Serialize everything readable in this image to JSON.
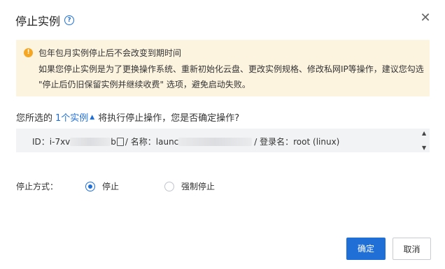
{
  "dialog": {
    "title": "停止实例",
    "close_glyph": "✕"
  },
  "notice": {
    "line1": "包年包月实例停止后不会改变到期时间",
    "line2": "如果您停止实例是为了更换操作系统、重新初始化云盘、更改实例规格、修改私网IP等操作，建议您勾选",
    "line3": "\"停止后仍旧保留实例并继续收费\" 选项，避免启动失败。"
  },
  "question": {
    "prefix": "您所选的",
    "link": "1个实例",
    "suffix": "将执行停止操作，您是否确定操作?"
  },
  "instance": {
    "id_prefix": "ID：i-7xv",
    "id_suffix": "b",
    "name_label": "/ 名称：",
    "name_prefix": "launc",
    "login_label": "/ 登录名：",
    "login_value": "root (linux)"
  },
  "stop_method": {
    "label": "停止方式：",
    "options": [
      {
        "label": "停止",
        "selected": true
      },
      {
        "label": "强制停止",
        "selected": false
      }
    ]
  },
  "buttons": {
    "confirm": "确定",
    "cancel": "取消"
  },
  "colors": {
    "accent": "#1f6fd6",
    "notice_bg": "#fdf4e0",
    "warning_icon": "#f5a623",
    "instance_bg": "#f2f3f5"
  }
}
